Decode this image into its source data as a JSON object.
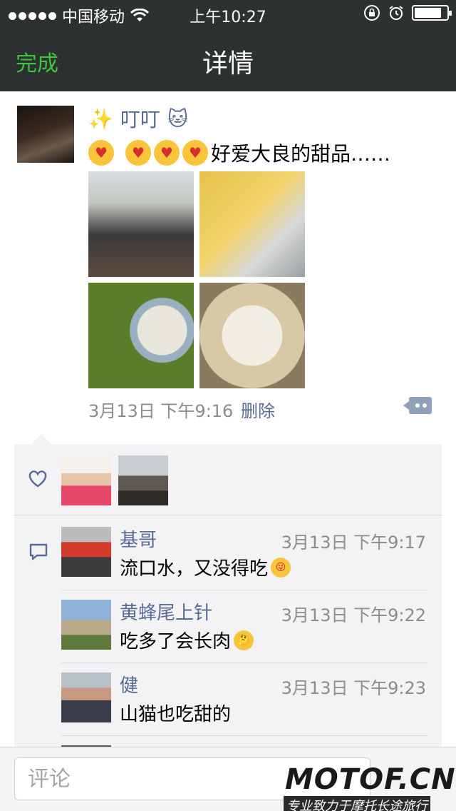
{
  "status_bar": {
    "carrier": "中国移动",
    "time": "上午10:27",
    "battery_level": 0.85
  },
  "nav": {
    "done_label": "完成",
    "title": "详情"
  },
  "post": {
    "author_name": "叮叮",
    "text": "好爱大良的甜品……",
    "timestamp": "3月13日 下午9:16",
    "delete_label": "删除",
    "photos": [
      "photo",
      "photo",
      "photo",
      "photo"
    ]
  },
  "comments": [
    {
      "name": "基哥",
      "time": "3月13日 下午9:17",
      "text": "流口水，又没得吃"
    },
    {
      "name": "黄蜂尾上针",
      "time": "3月13日 下午9:22",
      "text": "吃多了会长肉"
    },
    {
      "name": "健",
      "time": "3月13日 下午9:23",
      "text": "山猫也吃甜的"
    }
  ],
  "comment_input": {
    "placeholder": "评论"
  },
  "watermark": {
    "logo": "MOTOF.CN",
    "tagline": "专业致力于摩托长途旅行"
  },
  "colors": {
    "nav_bg": "#2e3132",
    "done_green": "#3ec43e",
    "link_blue": "#576b95",
    "panel_bg": "#f3f3f5"
  }
}
